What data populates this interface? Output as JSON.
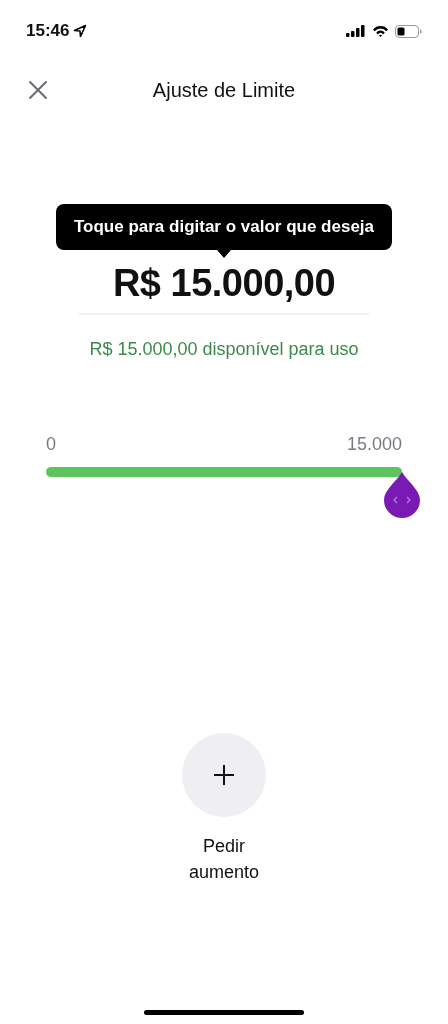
{
  "status_bar": {
    "time": "15:46"
  },
  "header": {
    "title": "Ajuste de Limite"
  },
  "tooltip": {
    "text": "Toque para digitar o valor que deseja"
  },
  "amount": {
    "value": "R$ 15.000,00"
  },
  "available": {
    "text": "R$ 15.000,00 disponível para uso"
  },
  "slider": {
    "min_label": "0",
    "max_label": "15.000",
    "level": 1.0
  },
  "action": {
    "label": "Pedir aumento"
  }
}
